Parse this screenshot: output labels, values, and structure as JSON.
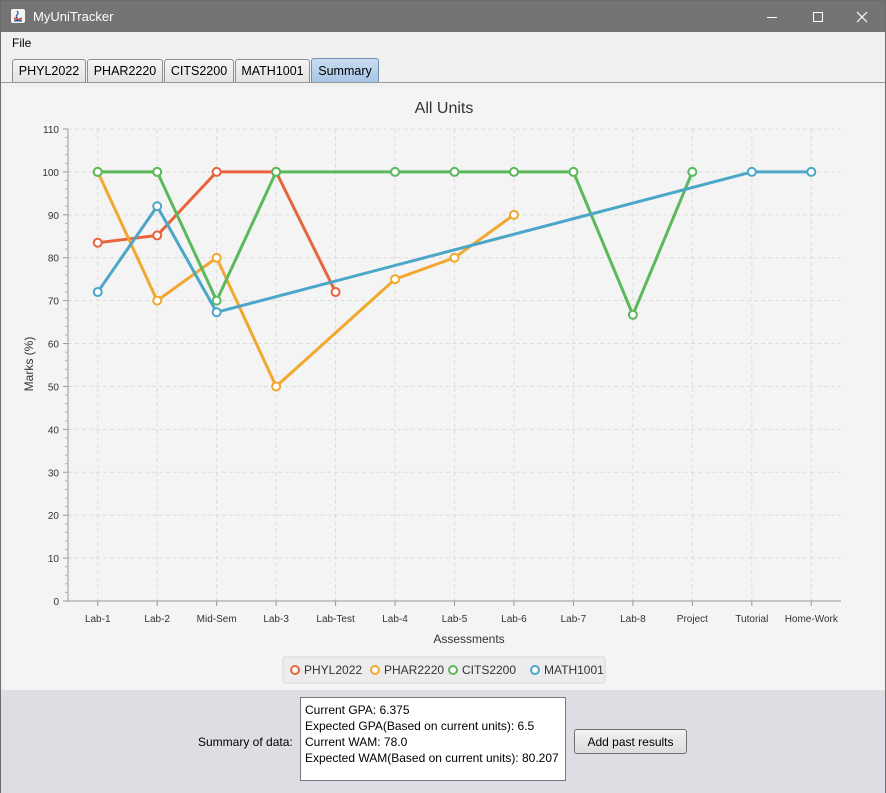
{
  "window": {
    "title": "MyUniTracker"
  },
  "menu": {
    "file_label": "File"
  },
  "tabs": [
    {
      "label": "PHYL2022"
    },
    {
      "label": "PHAR2220"
    },
    {
      "label": "CITS2200"
    },
    {
      "label": "MATH1001"
    },
    {
      "label": "Summary",
      "active": true
    }
  ],
  "chart_data": {
    "type": "line",
    "title": "All Units",
    "xlabel": "Assessments",
    "ylabel": "Marks (%)",
    "ylim": [
      0,
      110
    ],
    "yticks": [
      0,
      10,
      20,
      30,
      40,
      50,
      60,
      70,
      80,
      90,
      100,
      110
    ],
    "grid": true,
    "legend_position": "bottom",
    "categories": [
      "Lab-1",
      "Lab-2",
      "Mid-Sem",
      "Lab-3",
      "Lab-Test",
      "Lab-4",
      "Lab-5",
      "Lab-6",
      "Lab-7",
      "Lab-8",
      "Project",
      "Tutorial",
      "Home-Work"
    ],
    "series": [
      {
        "name": "PHYL2022",
        "color": "#e8643c",
        "points": [
          [
            "Lab-1",
            83.5
          ],
          [
            "Lab-2",
            85.2
          ],
          [
            "Mid-Sem",
            100
          ],
          [
            "Lab-3",
            100
          ],
          [
            "Lab-Test",
            72
          ]
        ]
      },
      {
        "name": "PHAR2220",
        "color": "#f0a830",
        "points": [
          [
            "Lab-1",
            100
          ],
          [
            "Lab-2",
            70
          ],
          [
            "Mid-Sem",
            80
          ],
          [
            "Lab-3",
            50
          ],
          [
            "Lab-4",
            75
          ],
          [
            "Lab-5",
            80
          ],
          [
            "Lab-6",
            90
          ]
        ]
      },
      {
        "name": "CITS2200",
        "color": "#5cb85c",
        "points": [
          [
            "Lab-1",
            100
          ],
          [
            "Lab-2",
            100
          ],
          [
            "Mid-Sem",
            70
          ],
          [
            "Lab-3",
            100
          ],
          [
            "Lab-4",
            100
          ],
          [
            "Lab-5",
            100
          ],
          [
            "Lab-6",
            100
          ],
          [
            "Lab-7",
            100
          ],
          [
            "Lab-8",
            66.7
          ],
          [
            "Project",
            100
          ]
        ]
      },
      {
        "name": "MATH1001",
        "color": "#4ba6c8",
        "points": [
          [
            "Lab-1",
            72
          ],
          [
            "Lab-2",
            92
          ],
          [
            "Mid-Sem",
            67.3
          ],
          [
            "Tutorial",
            100
          ],
          [
            "Home-Work",
            100
          ]
        ]
      }
    ]
  },
  "summary": {
    "label": "Summary of data:",
    "lines": [
      "Current GPA: 6.375",
      "Expected GPA(Based on current units): 6.5",
      "Current WAM: 78.0",
      "Expected WAM(Based on current units): 80.207"
    ],
    "add_button_label": "Add past results"
  }
}
